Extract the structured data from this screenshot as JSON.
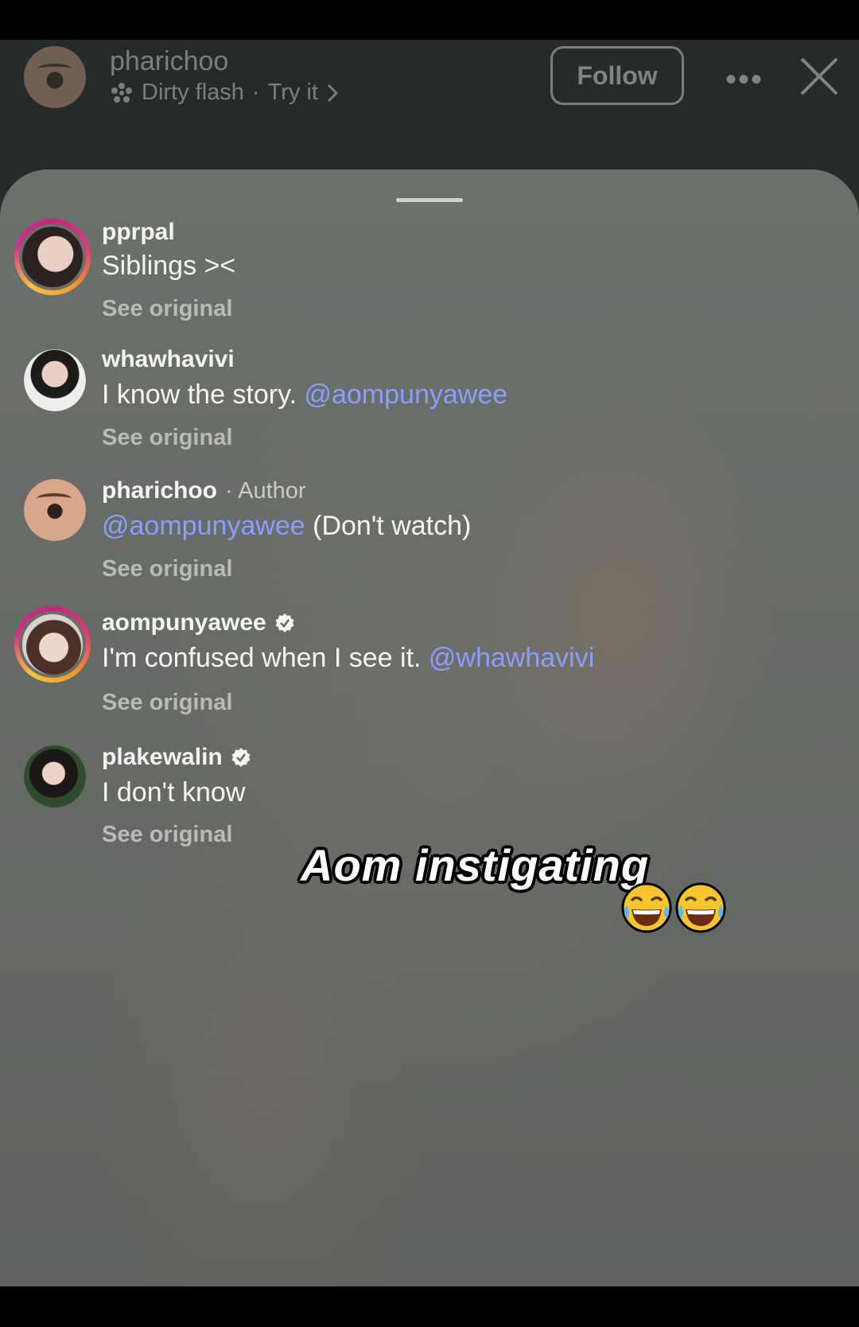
{
  "header": {
    "username": "pharichoo",
    "effect_name": "Dirty flash",
    "separator": "·",
    "try_label": "Try it",
    "follow_label": "Follow",
    "more_label": "•••"
  },
  "comments": [
    {
      "username": "pprpal",
      "text": "Siblings ><",
      "see_original": "See original",
      "story_ring": true
    },
    {
      "username": "whawhavivi",
      "text": "I know the story. ",
      "mention": "@aompunyawee",
      "see_original": "See original"
    },
    {
      "username": "pharichoo",
      "author_tag": "· Author",
      "mention": "@aompunyawee",
      "text_after": " (Don't watch)",
      "see_original": "See original"
    },
    {
      "username": "aompunyawee",
      "verified": true,
      "text": "I'm confused when I see it. ",
      "mention": "@whawhavivi",
      "see_original": "See original",
      "story_ring": true
    },
    {
      "username": "plakewalin",
      "verified": true,
      "text": "I don't know",
      "see_original": "See original"
    }
  ],
  "overlay_caption": "Aom instigating",
  "overlay_emojis": [
    "laughing-crying-emoji",
    "laughing-crying-emoji"
  ],
  "colors": {
    "mention": "#8c9cff",
    "sheet": "#676b66",
    "background": "#262a2a"
  }
}
